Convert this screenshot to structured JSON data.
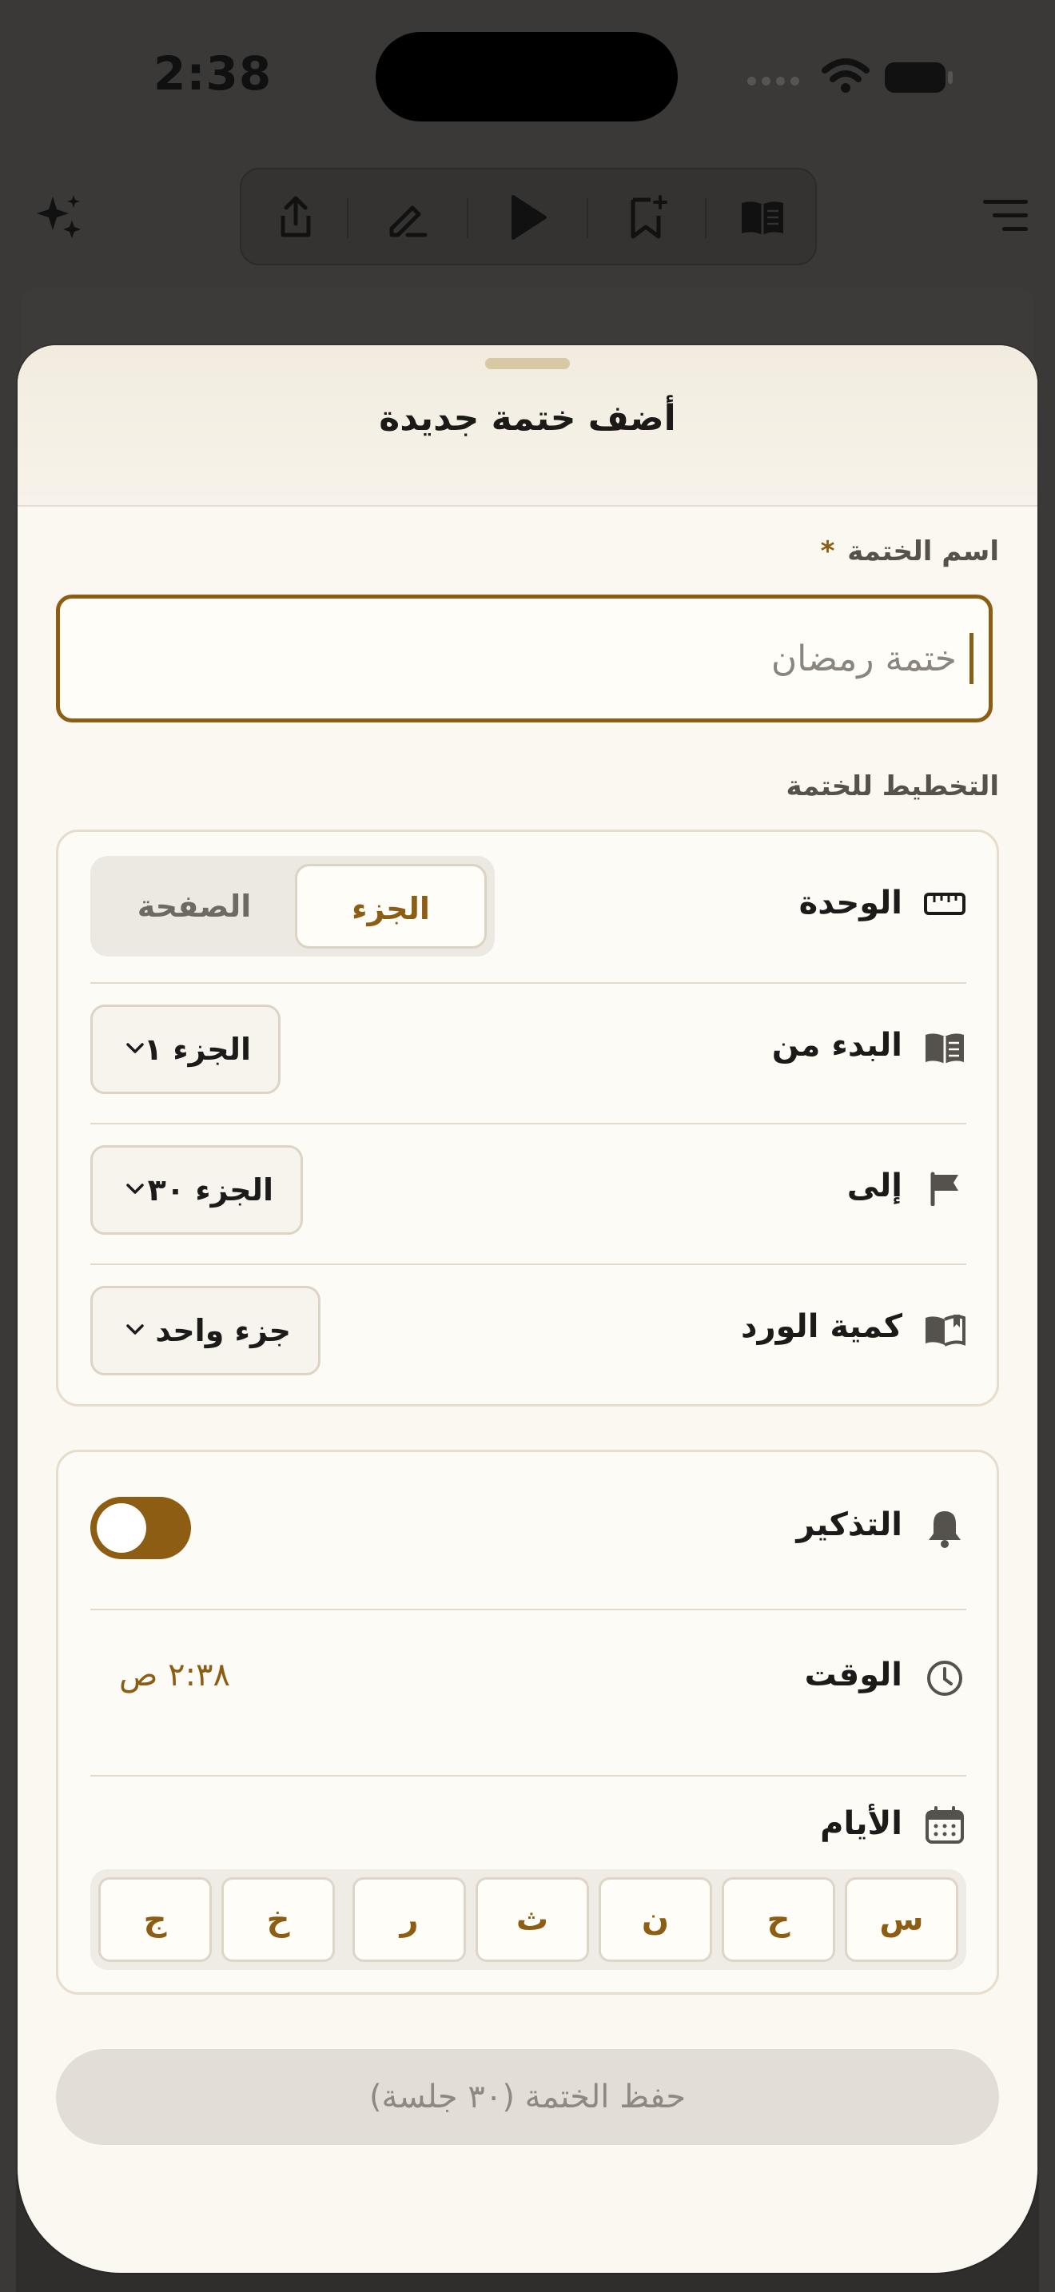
{
  "status_bar": {
    "time": "2:38"
  },
  "sheet": {
    "title": "أضف ختمة جديدة",
    "name_label": "اسم الختمة",
    "required_mark": "*",
    "name_placeholder": "ختمة رمضان",
    "plan_label": "التخطيط للختمة"
  },
  "plan": {
    "unit_label": "الوحدة",
    "unit_options": [
      "الجزء",
      "الصفحة"
    ],
    "unit_selected": "الجزء",
    "start_label": "البدء من",
    "start_value": "الجزء ١",
    "end_label": "إلى",
    "end_value": "الجزء ٣٠",
    "amount_label": "كمية الورد",
    "amount_value": "جزء واحد"
  },
  "reminder": {
    "label": "التذكير",
    "enabled": false,
    "time_label": "الوقت",
    "time_value": "٢:٣٨ ص",
    "days_label": "الأيام",
    "days": [
      "س",
      "ح",
      "ن",
      "ث",
      "ر",
      "خ",
      "ج"
    ]
  },
  "save_button": "حفظ الختمة (٣٠ جلسة)",
  "colors": {
    "accent": "#8c5d12",
    "background": "#fbf8f1",
    "border": "#e6ddcc"
  }
}
